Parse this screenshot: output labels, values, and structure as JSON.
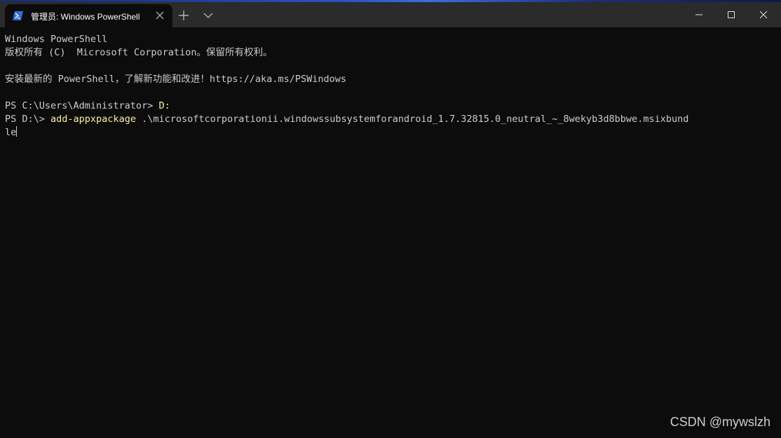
{
  "window": {
    "tab_title": "管理员: Windows PowerShell",
    "tab_icon": "powershell-icon",
    "new_tab_icon": "plus-icon",
    "dropdown_icon": "chevron-down-icon",
    "controls": [
      "minimize-icon",
      "maximize-icon",
      "close-icon"
    ]
  },
  "terminal": {
    "banner_line1": "Windows PowerShell",
    "banner_line2": "版权所有 (C)  Microsoft Corporation。保留所有权利。",
    "banner_line3": "安装最新的 PowerShell，了解新功能和改进！https://aka.ms/PSWindows",
    "prompt1": "PS C:\\Users\\Administrator> ",
    "cmd1": "D:",
    "prompt2": "PS D:\\> ",
    "cmd2": "add-appxpackage",
    "arg2": " .\\microsoftcorporationii.windowssubsystemforandroid_1.7.32815.0_neutral_~_8wekyb3d8bbwe.msixbund",
    "arg2_wrap": "le"
  },
  "watermark": "CSDN @mywslzh",
  "colors": {
    "background": "#0c0c0c",
    "titlebar": "#2b2b2b",
    "text": "#cccccc",
    "command": "#f9f1a5"
  }
}
